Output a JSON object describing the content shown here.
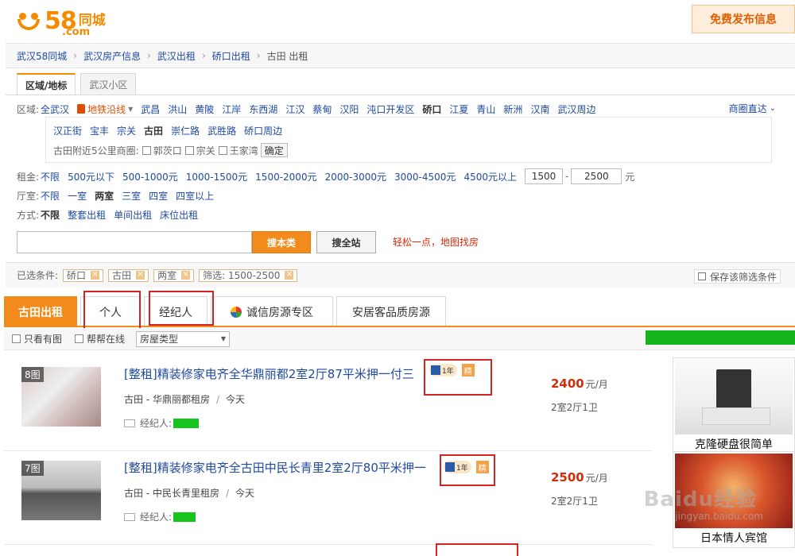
{
  "header": {
    "logo_number": "58",
    "logo_city": "同城",
    "logo_domain": ".com",
    "post_button": "免费发布信息"
  },
  "breadcrumb": [
    "武汉58同城",
    "武汉房产信息",
    "武汉出租",
    "硚口出租",
    "古田 出租"
  ],
  "filter_tabs": [
    "区域/地标",
    "武汉小区"
  ],
  "area": {
    "label": "区域:",
    "all": "全武汉",
    "subway": "地铁沿线",
    "districts": [
      "武昌",
      "洪山",
      "黄陂",
      "江岸",
      "东西湖",
      "江汉",
      "蔡甸",
      "汉阳",
      "沌口开发区",
      "硚口",
      "江夏",
      "青山",
      "新洲",
      "汉南",
      "武汉周边"
    ],
    "selected": "硚口",
    "shangquan": "商圈直达",
    "subareas": [
      "汉正街",
      "宝丰",
      "宗关",
      "古田",
      "崇仁路",
      "武胜路",
      "硚口周边"
    ],
    "selected_sub": "古田",
    "nearby_label": "古田附近5公里商圈:",
    "nearby": [
      "郭茨口",
      "宗关",
      "王家湾"
    ],
    "confirm": "确定"
  },
  "rent": {
    "label": "租金:",
    "options": [
      "不限",
      "500元以下",
      "500-1000元",
      "1000-1500元",
      "1500-2000元",
      "2000-3000元",
      "3000-4500元",
      "4500元以上"
    ],
    "min": "1500",
    "max": "2500",
    "dash": "-",
    "unit": "元"
  },
  "rooms": {
    "label": "厅室:",
    "options": [
      "不限",
      "一室",
      "两室",
      "三室",
      "四室",
      "四室以上"
    ],
    "selected": "两室"
  },
  "mode": {
    "label": "方式:",
    "options": [
      "不限",
      "整套出租",
      "单间出租",
      "床位出租"
    ],
    "selected": "不限"
  },
  "search": {
    "input_value": "",
    "this_button": "搜本类",
    "all_button": "搜全站",
    "map_link": "轻松一点，地图找房"
  },
  "selected_filters": {
    "label": "已选条件:",
    "chips": [
      "硚口",
      "古田",
      "两室",
      "筛选: 1500-2500"
    ],
    "save": "保存该筛选条件"
  },
  "listing_tabs": [
    "古田出租",
    "个人",
    "经纪人",
    "诚信房源专区",
    "安居客品质房源"
  ],
  "options_bar": {
    "image_only": "只看有图",
    "online": "帮帮在线",
    "house_type": "房屋类型"
  },
  "listings": [
    {
      "image_count": "8图",
      "title": "[整租]精装修家电齐全华鼎丽都2室2厅87平米押一付三",
      "badge_year": "1年",
      "badge_jing": "精",
      "location": "古田 - 华鼎丽都租房",
      "time": "今天",
      "agent_label": "经纪人:",
      "price": "2400",
      "price_unit": "元/月",
      "rooms": "2室2厅1卫"
    },
    {
      "image_count": "7图",
      "title": "[整租]精装修家电齐全古田中民长青里2室2厅80平米押一",
      "badge_year": "1年",
      "badge_jing": "精",
      "location": "古田 - 中民长青里租房",
      "time": "今天",
      "agent_label": "经纪人:",
      "price": "2500",
      "price_unit": "元/月",
      "rooms": "2室2厅1卫"
    }
  ],
  "ads": [
    {
      "caption": "克隆硬盘很简单"
    },
    {
      "caption": "日本情人宾馆"
    }
  ],
  "watermark": {
    "text": "Baidu经验",
    "url": "jingyan.baidu.com"
  },
  "colors": {
    "brand": "#f48b00",
    "accent": "#f28a1c",
    "link": "#1f4aa0",
    "price": "#d52c0a",
    "highlight_box": "#d32424"
  }
}
